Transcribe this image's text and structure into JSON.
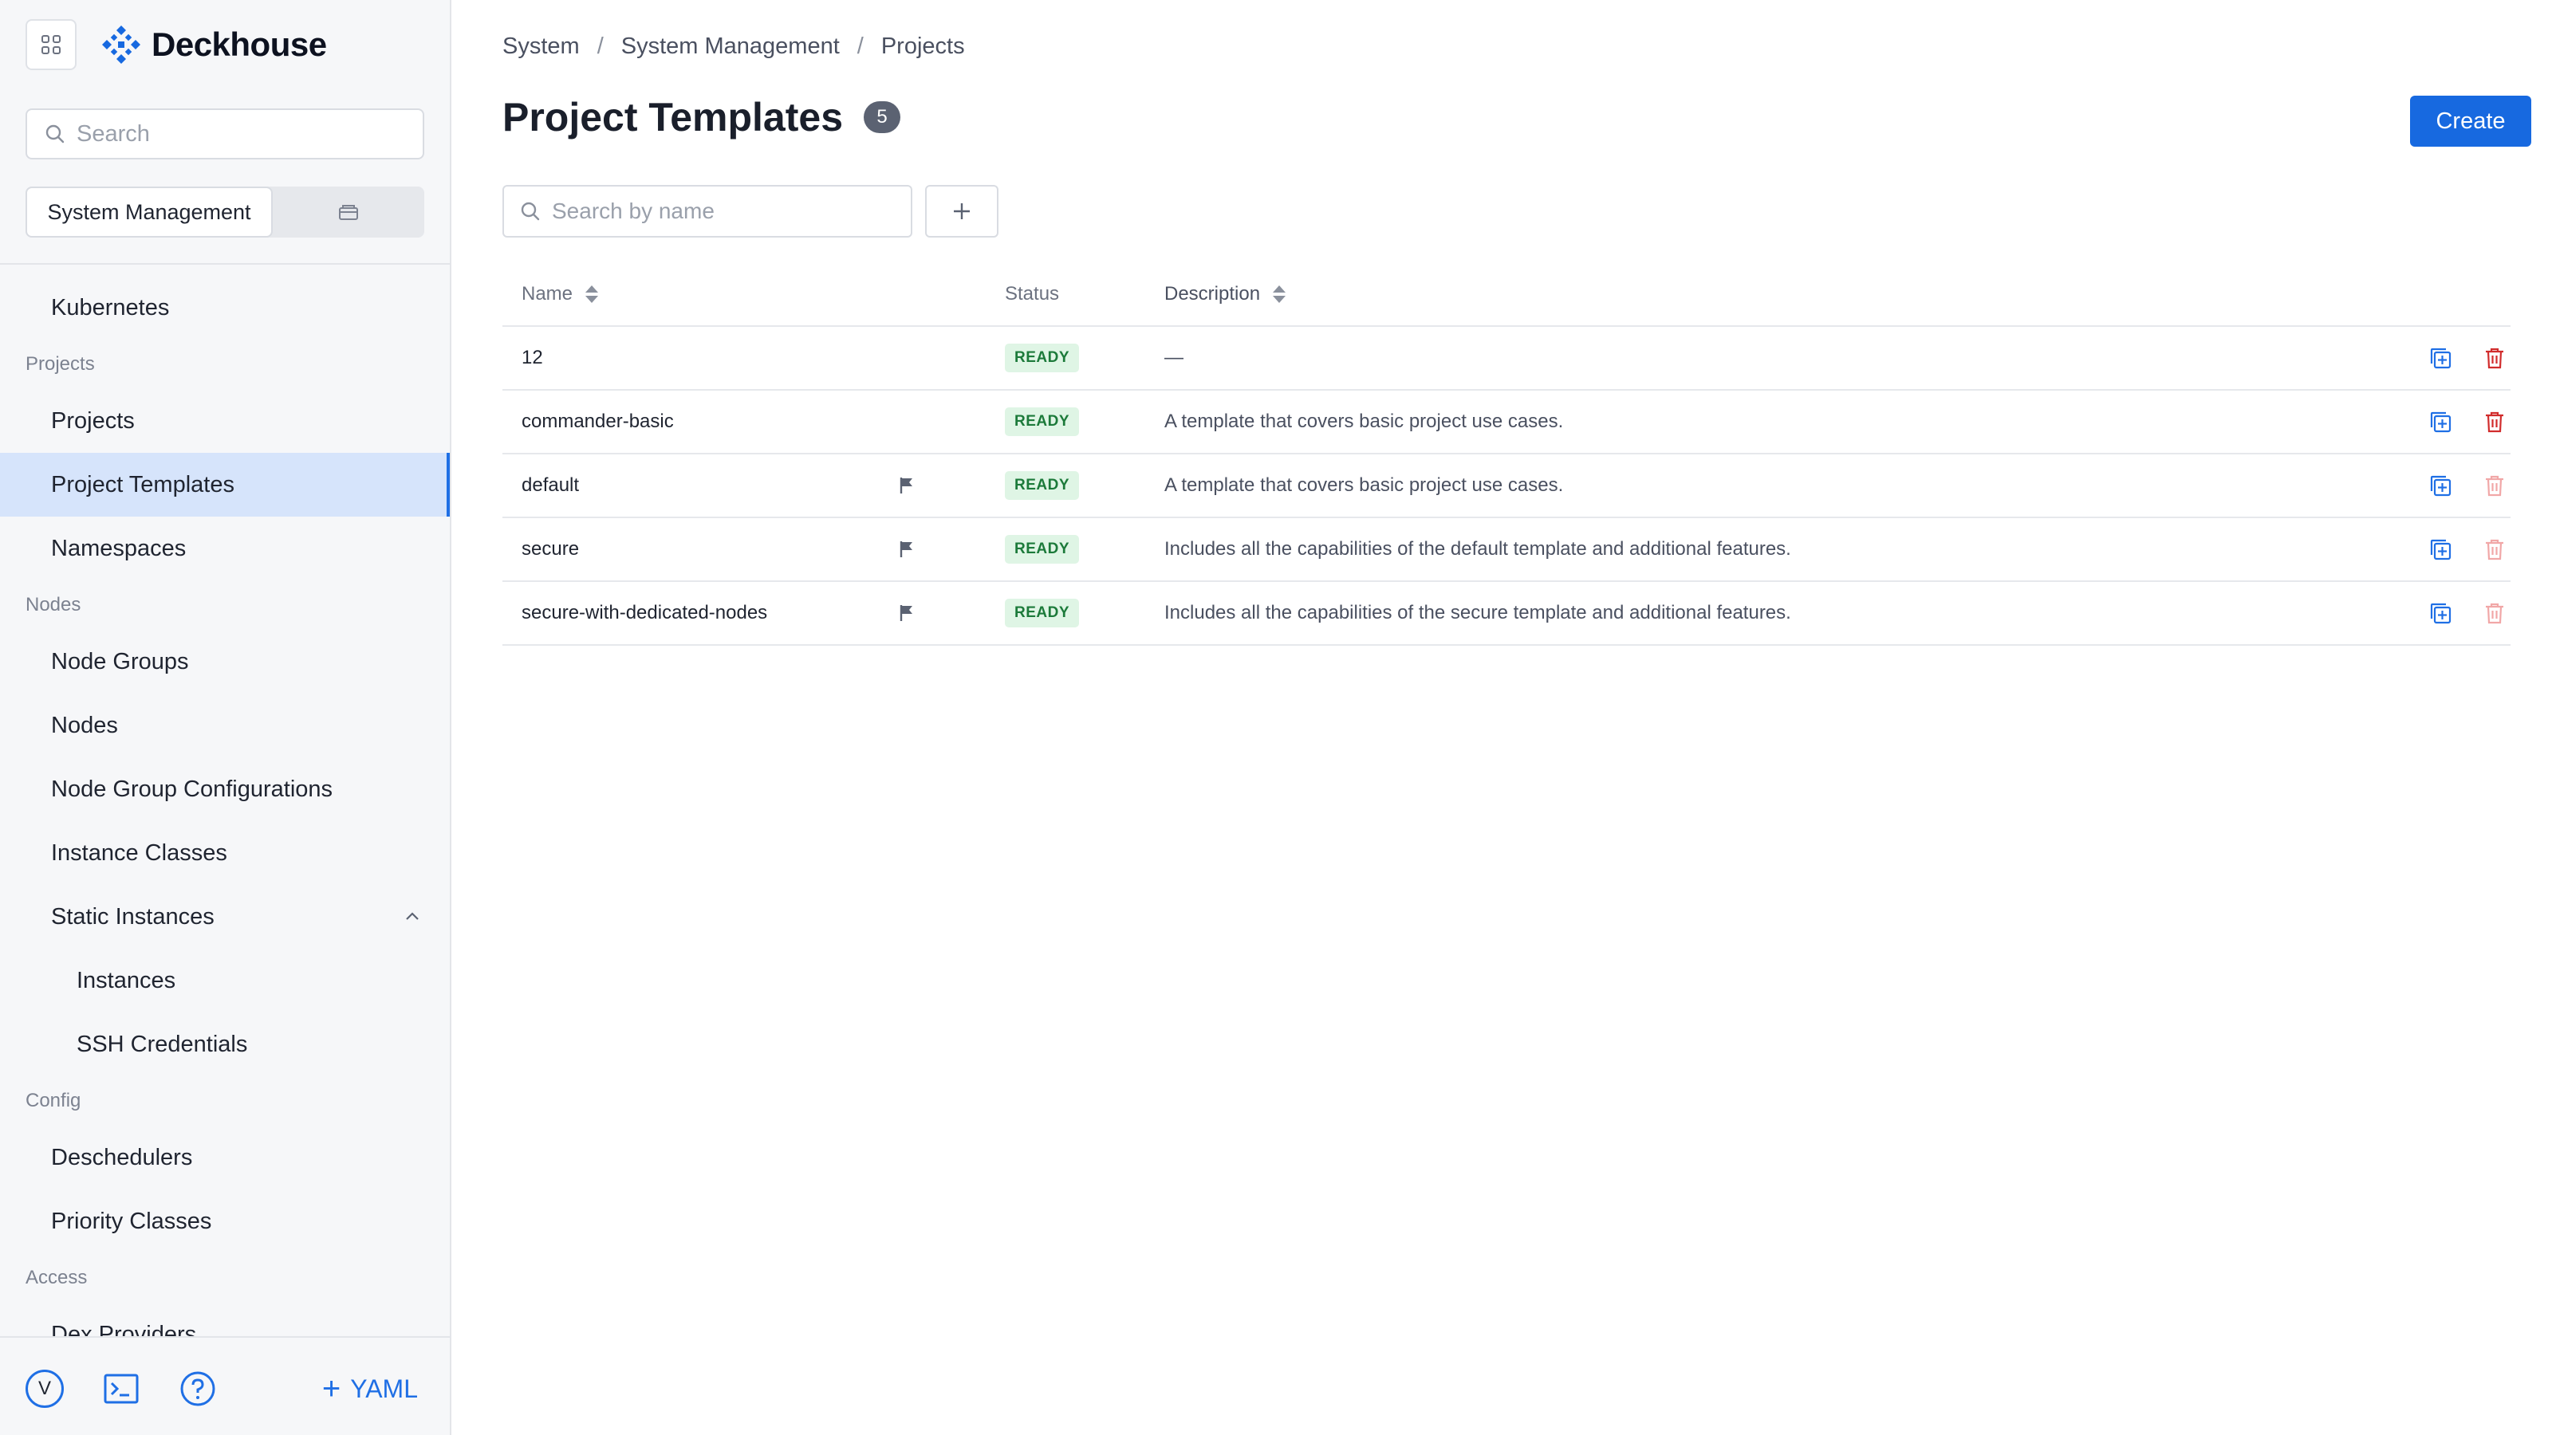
{
  "app": {
    "brand": "Deckhouse",
    "accent_color": "#1769e0"
  },
  "sidebar": {
    "search_placeholder": "Search",
    "switcher": {
      "active_label": "System Management",
      "inactive_icon": "folder-icon"
    },
    "nav": [
      {
        "type": "item",
        "label": "Kubernetes"
      },
      {
        "type": "section",
        "label": "Projects"
      },
      {
        "type": "item",
        "label": "Projects"
      },
      {
        "type": "item",
        "label": "Project Templates",
        "active": true
      },
      {
        "type": "item",
        "label": "Namespaces"
      },
      {
        "type": "section",
        "label": "Nodes"
      },
      {
        "type": "item",
        "label": "Node Groups"
      },
      {
        "type": "item",
        "label": "Nodes"
      },
      {
        "type": "item",
        "label": "Node Group Configurations"
      },
      {
        "type": "item",
        "label": "Instance Classes"
      },
      {
        "type": "item",
        "label": "Static Instances",
        "expanded": true
      },
      {
        "type": "subitem",
        "label": "Instances"
      },
      {
        "type": "subitem",
        "label": "SSH Credentials"
      },
      {
        "type": "section",
        "label": "Config"
      },
      {
        "type": "item",
        "label": "Deschedulers"
      },
      {
        "type": "item",
        "label": "Priority Classes"
      },
      {
        "type": "section",
        "label": "Access"
      },
      {
        "type": "item",
        "label": "Dex Providers"
      }
    ],
    "bottom": {
      "avatar_letter": "V",
      "yaml_label": "YAML"
    }
  },
  "header": {
    "breadcrumb": [
      "System",
      "System Management",
      "Projects"
    ],
    "title": "Project Templates",
    "count": "5",
    "create_label": "Create"
  },
  "filters": {
    "search_placeholder": "Search by name"
  },
  "table": {
    "columns": {
      "name": "Name",
      "status": "Status",
      "description": "Description"
    },
    "rows": [
      {
        "name": "12",
        "flagged": false,
        "status": "READY",
        "description": "—",
        "deletable": true
      },
      {
        "name": "commander-basic",
        "flagged": false,
        "status": "READY",
        "description": "A template that covers basic project use cases.",
        "deletable": true
      },
      {
        "name": "default",
        "flagged": true,
        "status": "READY",
        "description": "A template that covers basic project use cases.",
        "deletable": false
      },
      {
        "name": "secure",
        "flagged": true,
        "status": "READY",
        "description": "Includes all the capabilities of the default template and additional features.",
        "deletable": false
      },
      {
        "name": "secure-with-dedicated-nodes",
        "flagged": true,
        "status": "READY",
        "description": "Includes all the capabilities of the secure template and additional features.",
        "deletable": false
      }
    ]
  }
}
